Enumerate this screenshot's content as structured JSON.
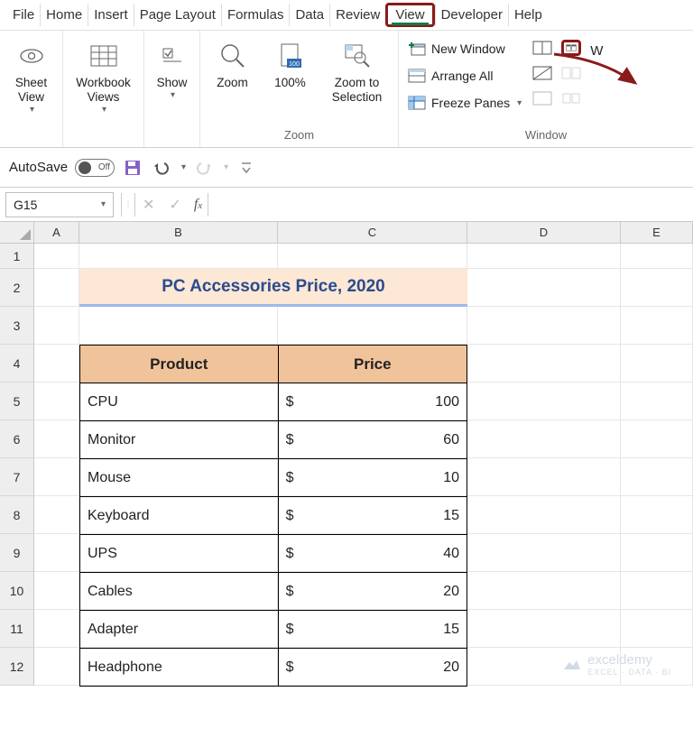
{
  "menu": {
    "items": [
      "File",
      "Home",
      "Insert",
      "Page Layout",
      "Formulas",
      "Data",
      "Review",
      "View",
      "Developer",
      "Help"
    ],
    "active": "View"
  },
  "ribbon": {
    "sheetView": {
      "label": "Sheet View"
    },
    "workbookViews": {
      "label": "Workbook Views"
    },
    "show": {
      "label": "Show"
    },
    "zoom": {
      "group": "Zoom",
      "zoom": "Zoom",
      "hundred": "100%",
      "sel": "Zoom to Selection"
    },
    "window": {
      "group": "Window",
      "newWindow": "New Window",
      "arrangeAll": "Arrange All",
      "freezePanes": "Freeze Panes"
    }
  },
  "qat": {
    "autosave": "AutoSave",
    "toggle": "Off"
  },
  "nameBox": "G15",
  "colHeaders": [
    "A",
    "B",
    "C",
    "D",
    "E"
  ],
  "rowHeaders": [
    "1",
    "2",
    "3",
    "4",
    "5",
    "6",
    "7",
    "8",
    "9",
    "10",
    "11",
    "12"
  ],
  "sheet": {
    "title": "PC Accessories Price, 2020",
    "headers": {
      "product": "Product",
      "price": "Price"
    },
    "currency": "$",
    "rows": [
      {
        "product": "CPU",
        "price": 100
      },
      {
        "product": "Monitor",
        "price": 60
      },
      {
        "product": "Mouse",
        "price": 10
      },
      {
        "product": "Keyboard",
        "price": 15
      },
      {
        "product": "UPS",
        "price": 40
      },
      {
        "product": "Cables",
        "price": 20
      },
      {
        "product": "Adapter",
        "price": 15
      },
      {
        "product": "Headphone",
        "price": 20
      }
    ]
  },
  "watermark": {
    "brand": "exceldemy",
    "tag": "EXCEL · DATA · BI"
  }
}
